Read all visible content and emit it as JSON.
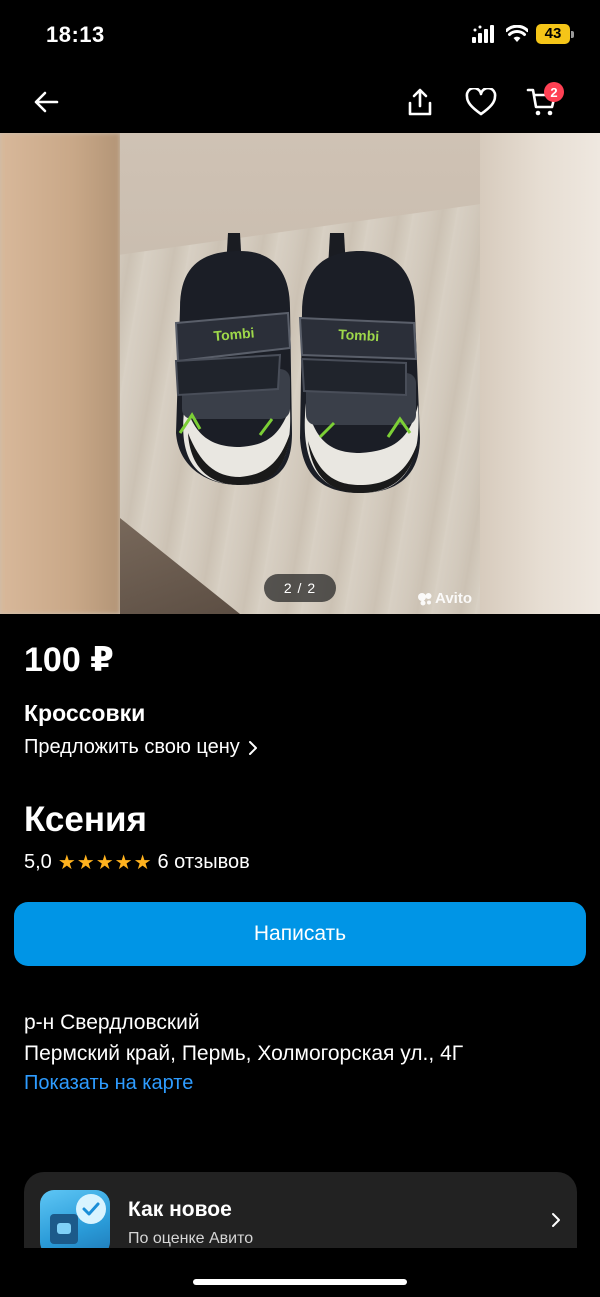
{
  "status_bar": {
    "time": "18:13",
    "battery": "43"
  },
  "nav": {
    "cart_count": "2"
  },
  "gallery": {
    "counter": "2 / 2",
    "watermark": "Avito",
    "photo_brand": "Tombi"
  },
  "listing": {
    "price": "100 ₽",
    "title": "Кроссовки",
    "offer_price_label": "Предложить свою цену"
  },
  "seller": {
    "name": "Ксения",
    "rating": "5,0",
    "stars": 5,
    "reviews": "6 отзывов"
  },
  "actions": {
    "write_label": "Написать"
  },
  "location": {
    "district": "р-н Свердловский",
    "address": "Пермский край, Пермь, Холмогорская ул., 4Г",
    "map_link": "Показать на карте"
  },
  "condition_card": {
    "title": "Как новое",
    "subtitle": "По оценке Авито"
  },
  "colors": {
    "accent": "#0095e6",
    "link": "#2e9cff",
    "star": "#ffb21e",
    "badge": "#ff4053"
  }
}
